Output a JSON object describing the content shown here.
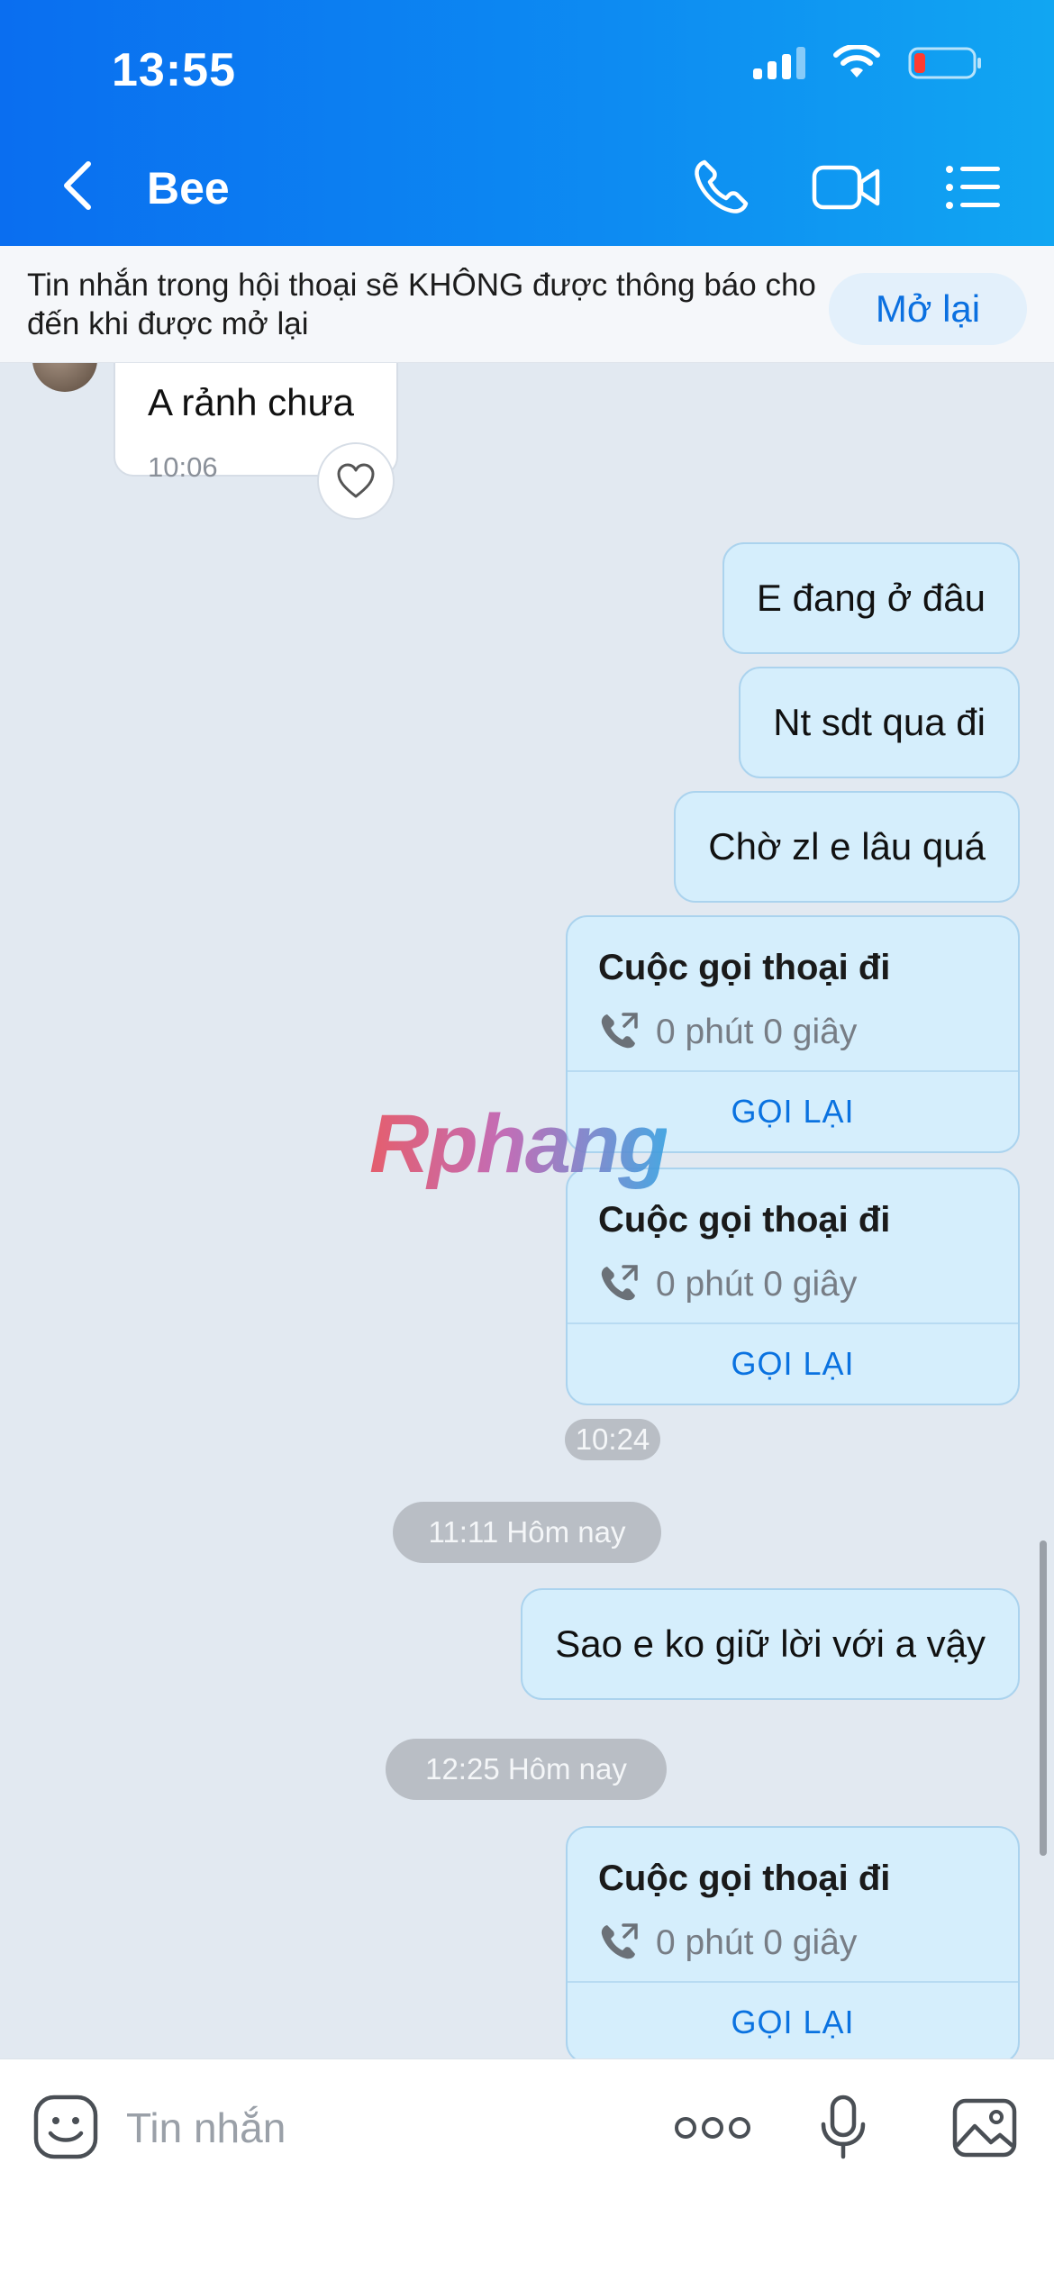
{
  "status_bar": {
    "time": "13:55"
  },
  "header": {
    "contact_name": "Bee"
  },
  "mute_banner": {
    "text": "Tin nhắn trong hội thoại sẽ KHÔNG được thông báo cho đến khi được mở lại",
    "button": "Mở lại"
  },
  "incoming": {
    "text": "A rảnh chưa",
    "time": "10:06"
  },
  "outgoing": [
    {
      "text": "E đang ở đâu"
    },
    {
      "text": "Nt sdt qua đi"
    },
    {
      "text": "Chờ zl e lâu quá"
    },
    {
      "text": "Sao e ko giữ lời với a vậy"
    }
  ],
  "calls": [
    {
      "title": "Cuộc gọi thoại đi",
      "duration": "0 phút 0 giây",
      "action": "GỌI LẠI"
    },
    {
      "title": "Cuộc gọi thoại đi",
      "duration": "0 phút 0 giây",
      "action": "GỌI LẠI"
    },
    {
      "title": "Cuộc gọi thoại đi",
      "duration": "0 phút 0 giây",
      "action": "GỌI LẠI"
    }
  ],
  "timestamps": {
    "t1": "10:24",
    "t2": "11:11 Hôm nay",
    "t3": "12:25 Hôm nay"
  },
  "watermark": "Rphang",
  "composer": {
    "placeholder": "Tin nhắn"
  }
}
